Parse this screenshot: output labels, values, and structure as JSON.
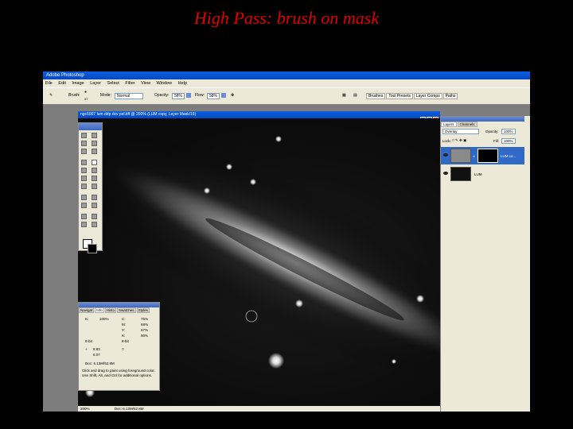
{
  "slide": {
    "title": "High Pass: brush on mask"
  },
  "app": {
    "title": "Adobe Photoshop",
    "menu": [
      "File",
      "Edit",
      "Image",
      "Layer",
      "Select",
      "Filter",
      "View",
      "Window",
      "Help"
    ],
    "options": {
      "brush_label": "Brush:",
      "brush_size": "37",
      "mode_label": "Mode:",
      "mode_value": "Normal",
      "opacity_label": "Opacity:",
      "opacity_value": "58%",
      "flow_label": "Flow:",
      "flow_value": "58%",
      "palette_tabs": [
        "Brushes",
        "Tool Presets",
        "Layer Comps",
        "Paths"
      ]
    },
    "document": {
      "title": "ngc5907 lum ddp dcv pel.tiff @ 200% (LUM copy, Layer Mask/16)",
      "zoom": "200%",
      "doc_size": "Doc: 6.13M/52.8M"
    },
    "info_panel": {
      "tabs": [
        "Navigat",
        "Info",
        "Histo",
        "Swatches",
        "Styles"
      ],
      "rows": [
        {
          "left_label": "K:",
          "left_val": "100%",
          "right_label": "C:",
          "right_val": "75%"
        },
        {
          "left_label": "",
          "left_val": "",
          "right_label": "M:",
          "right_val": "68%"
        },
        {
          "left_label": "",
          "left_val": "",
          "right_label": "Y:",
          "right_val": "67%"
        },
        {
          "left_label": "",
          "left_val": "",
          "right_label": "K:",
          "right_val": "90%"
        }
      ],
      "bitdepth_left": "8-bit",
      "bitdepth_right": "8-bit",
      "xy_x": "8.83",
      "xy_y": "6.07",
      "wh_w": "",
      "wh_h": "",
      "doc": "Doc: 6.13M/52.8M",
      "note": "Click and drag to paint using foreground color. Use Shift, Alt, and Ctrl for additional options."
    },
    "layers_panel": {
      "tabs": [
        "Layers",
        "Channels"
      ],
      "blend_mode": "Overlay",
      "opacity_label": "Opacity:",
      "opacity_value": "100%",
      "lock_label": "Lock:",
      "fill_label": "Fill:",
      "fill_value": "100%",
      "layers": [
        {
          "name": "LUM co..."
        },
        {
          "name": "LUM"
        }
      ]
    },
    "icons": [
      "brush-icon",
      "airbrush-icon",
      "eye-icon",
      "chain-icon"
    ]
  }
}
